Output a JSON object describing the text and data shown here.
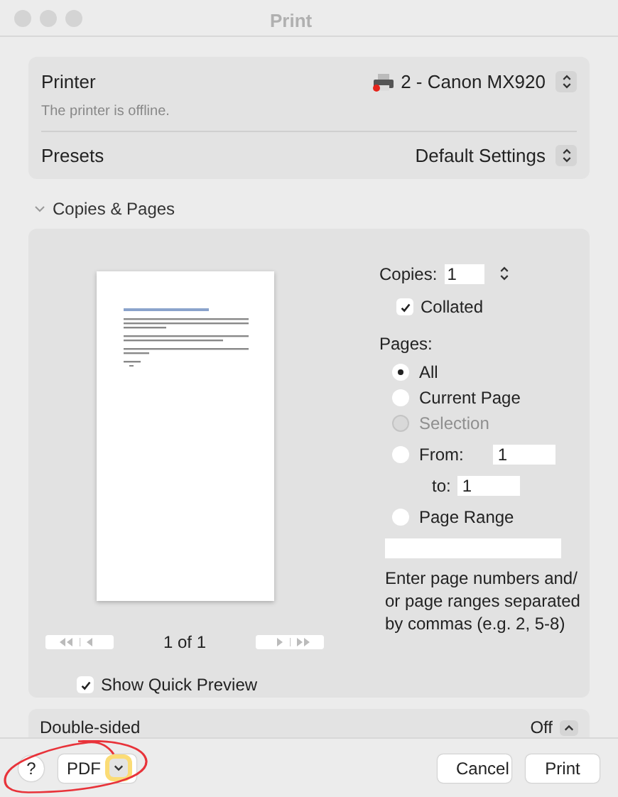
{
  "window": {
    "title": "Print"
  },
  "printer": {
    "label": "Printer",
    "value": "2 - Canon MX920",
    "status": "The printer is offline."
  },
  "presets": {
    "label": "Presets",
    "value": "Default Settings"
  },
  "section": {
    "title": "Copies & Pages",
    "expanded": true
  },
  "copies": {
    "label": "Copies:",
    "value": "1"
  },
  "collated": {
    "label": "Collated",
    "checked": true
  },
  "pages": {
    "label": "Pages:",
    "options": [
      {
        "kind": "plain",
        "label": "All",
        "selected": true,
        "disabled": false
      },
      {
        "kind": "plain",
        "label": "Current Page",
        "selected": false,
        "disabled": false
      },
      {
        "kind": "plain",
        "label": "Selection",
        "selected": false,
        "disabled": true
      },
      {
        "kind": "from",
        "label": "From:",
        "value": "1",
        "to_label": "to:",
        "to_value": "1",
        "selected": false,
        "disabled": false
      },
      {
        "kind": "range",
        "label": "Page Range",
        "selected": false,
        "disabled": false
      }
    ],
    "help": "Enter page numbers and/ or page ranges separated by commas (e.g. 2, 5-8)"
  },
  "preview": {
    "page_indicator": "1 of 1",
    "quick_preview": {
      "label": "Show Quick Preview",
      "checked": true
    }
  },
  "double_sided": {
    "label": "Double-sided",
    "value": "Off"
  },
  "footer": {
    "help": "?",
    "pdf": "PDF",
    "buttons": [
      "Cancel",
      "Print"
    ]
  }
}
